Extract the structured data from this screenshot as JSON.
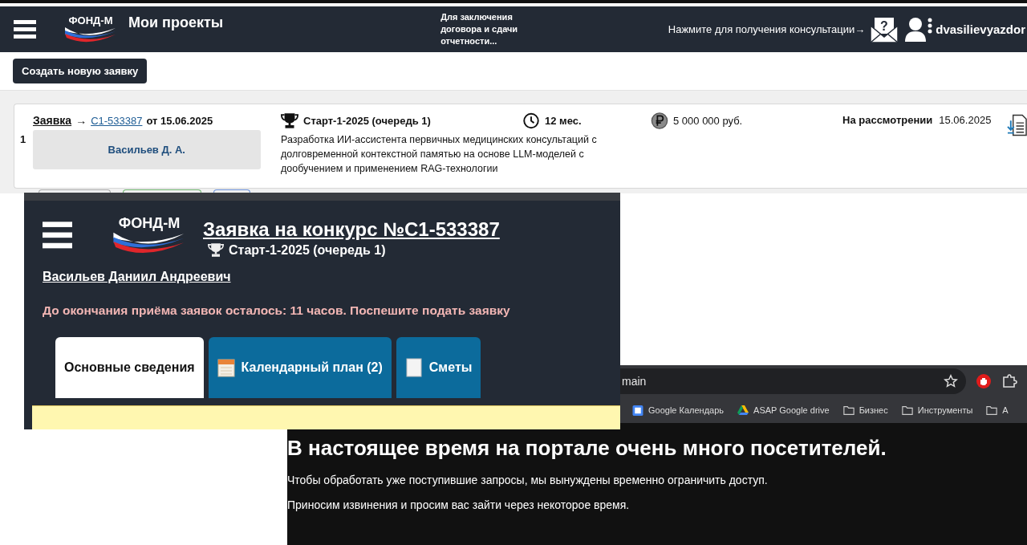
{
  "header": {
    "logo": "ФОНД-М",
    "title": "Мои проекты",
    "notice": "Для заключения договора и сдачи отчетности...",
    "consult": "Нажмите для получения консультации→",
    "consult_mark": "?",
    "username": "dvasilievyazdor"
  },
  "create_button": "Создать новую заявку",
  "applications": [
    {
      "index": "1",
      "link_label": "Заявка",
      "arrow": "→",
      "code": "C1-533387",
      "date": "от 15.06.2025",
      "applicant": "Васильев Д. А.",
      "contest": "Старт-1-2025 (очередь 1)",
      "description": "Разработка ИИ-ассистента первичных медицинских консультаций с долговременной контекстной памятью на основе LLM-моделей с дообучением и применением RAG-технологии",
      "duration": "12 мес.",
      "amount": "5 000 000 руб.",
      "status": "На рассмотрении",
      "status_date": "15.06.2025"
    }
  ],
  "application_window": {
    "logo": "ФОНД-М",
    "title": "Заявка на конкурс №C1-533387",
    "contest": "Старт-1-2025 (очередь 1)",
    "applicant": "Васильев Даниил Андреевич",
    "deadline_notice": "До окончания приёма заявок осталось: 11 часов. Поспешите подать заявку",
    "tabs": [
      {
        "label": "Основные сведения",
        "selected": true,
        "kind": "plain"
      },
      {
        "label": "Календарный план (2)",
        "selected": false,
        "kind": "calendar"
      },
      {
        "label": "Сметы",
        "selected": false,
        "kind": "sheet"
      }
    ]
  },
  "browser": {
    "url": "main",
    "bookmarks": [
      {
        "label": "Google Календарь",
        "kind": "calendar"
      },
      {
        "label": "ASAP Google drive",
        "kind": "drive"
      },
      {
        "label": "Бизнес",
        "kind": "folder"
      },
      {
        "label": "Инструменты",
        "kind": "folder"
      },
      {
        "label": "А",
        "kind": "folder"
      }
    ],
    "page": {
      "heading": "В настоящее время на портале очень много посетителей.",
      "paragraphs": [
        "Чтобы обработать уже поступившие запросы, мы вынуждены временно ограничить доступ.",
        "Приносим извинения и просим вас зайти через некоторое время."
      ]
    }
  }
}
